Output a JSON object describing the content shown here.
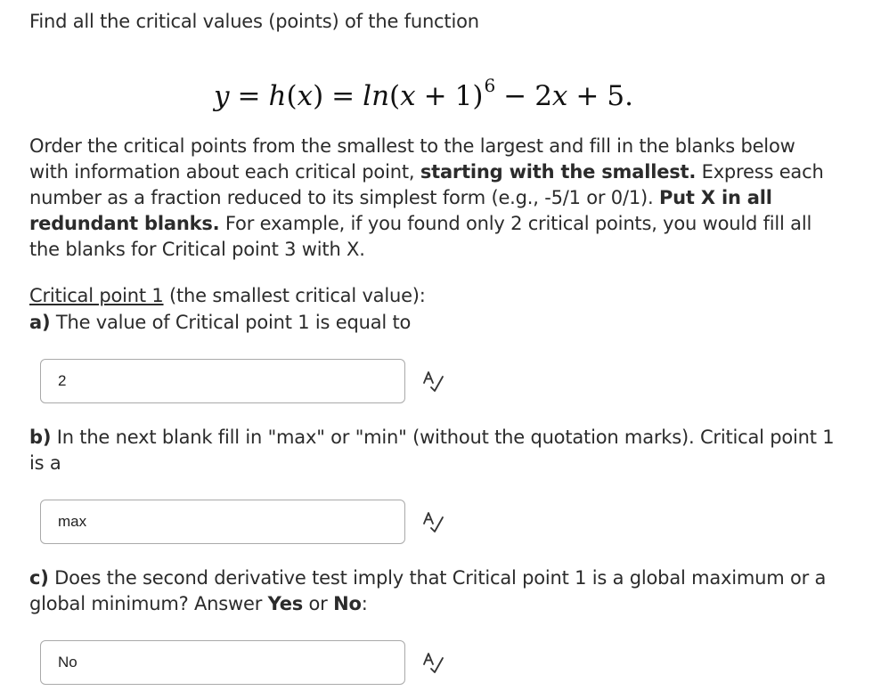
{
  "question": {
    "intro": "Find all the critical values (points) of the function",
    "formula": {
      "y": "y",
      "eq1": "=",
      "h": "h",
      "hx_open": "(",
      "hx_var": "x",
      "hx_close": ")",
      "eq2": "=",
      "ln": "ln",
      "arg_open": "(",
      "arg_var": "x",
      "arg_plus": "+",
      "arg_one": "1",
      "arg_close": ")",
      "exponent": "6",
      "minus": "−",
      "coef": "2",
      "coef_var": "x",
      "plus": "+",
      "const": "5",
      "period": "."
    },
    "instructions": {
      "t1": "Order the critical points from the smallest to the largest and fill in the blanks below with information about each critical point, ",
      "b1": "starting with the smallest.",
      "t2": " Express each number as a fraction reduced to its simplest form (e.g., -5/1 or 0/1). ",
      "b2": "Put X in all redundant blanks.",
      "t3": " For example, if you found only 2 critical points, you would fill all the blanks for Critical point 3 with X."
    }
  },
  "critical_point_1": {
    "heading_link": "Critical point 1",
    "heading_rest": " (the smallest critical value):",
    "part_a": {
      "label": "a)",
      "text": " The value of Critical point 1 is equal to",
      "answer": "2"
    },
    "part_b": {
      "label": "b)",
      "text": " In the next blank fill in \"max\" or \"min\" (without the quotation marks). Critical point 1 is a",
      "answer": "max"
    },
    "part_c": {
      "label": "c)",
      "text1": " Does the second derivative test imply that Critical point 1 is a global maximum or a global minimum? Answer ",
      "yes": "Yes",
      "or": " or ",
      "no": "No",
      "colon": ":",
      "answer": "No"
    }
  },
  "icons": {
    "spellcheck": "spellcheck-icon"
  }
}
